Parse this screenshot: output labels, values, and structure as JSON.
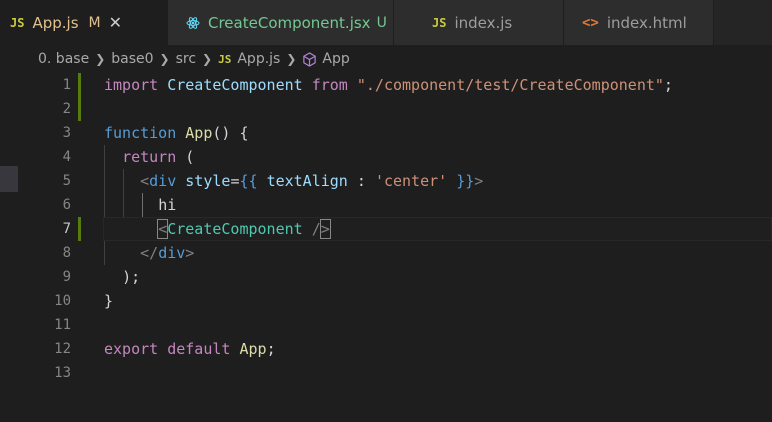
{
  "tabs": [
    {
      "icon": "JS",
      "label": "App.js",
      "status": "M",
      "close": "✕",
      "active": true
    },
    {
      "icon": "react",
      "label": "CreateComponent.jsx",
      "status": "U",
      "active": false
    },
    {
      "icon": "JS",
      "label": "index.js",
      "active": false
    },
    {
      "icon": "<>",
      "label": "index.html",
      "active": false
    }
  ],
  "breadcrumb": {
    "items": [
      "0. base",
      "base0",
      "src"
    ],
    "file_icon": "JS",
    "file": "App.js",
    "symbol": "App"
  },
  "code": {
    "line_numbers": [
      "1",
      "2",
      "3",
      "4",
      "5",
      "6",
      "7",
      "8",
      "9",
      "10",
      "11",
      "12",
      "13"
    ],
    "l1": {
      "import": "import",
      "name": "CreateComponent",
      "from": "from",
      "path": "\"./component/test/CreateComponent\"",
      "semi": ";"
    },
    "l3": {
      "function": "function",
      "name": "App",
      "rest": "() {"
    },
    "l4": {
      "ret": "return",
      "paren": "("
    },
    "l5": {
      "open": "<",
      "tag": "div",
      "attr": "style",
      "eq": "=",
      "b1": "{{",
      "prop": "textAlign",
      "colon": " : ",
      "val": "'center'",
      "b2": "}}",
      "close": ">"
    },
    "l6": {
      "text": "hi"
    },
    "l7": {
      "open": "<",
      "comp": "CreateComponent",
      "slash": " /",
      "close": ">"
    },
    "l8": {
      "open": "</",
      "tag": "div",
      "close": ">"
    },
    "l9": {
      "text": ");"
    },
    "l10": {
      "text": "}"
    },
    "l12": {
      "export": "export",
      "def": "default",
      "name": "App",
      "semi": ";"
    }
  },
  "colors": {
    "accent_added": "#587c0c",
    "keyword": "#569cd6",
    "control": "#c586c0",
    "function": "#dcdcaa",
    "string": "#ce9178",
    "component": "#4ec9b0"
  }
}
